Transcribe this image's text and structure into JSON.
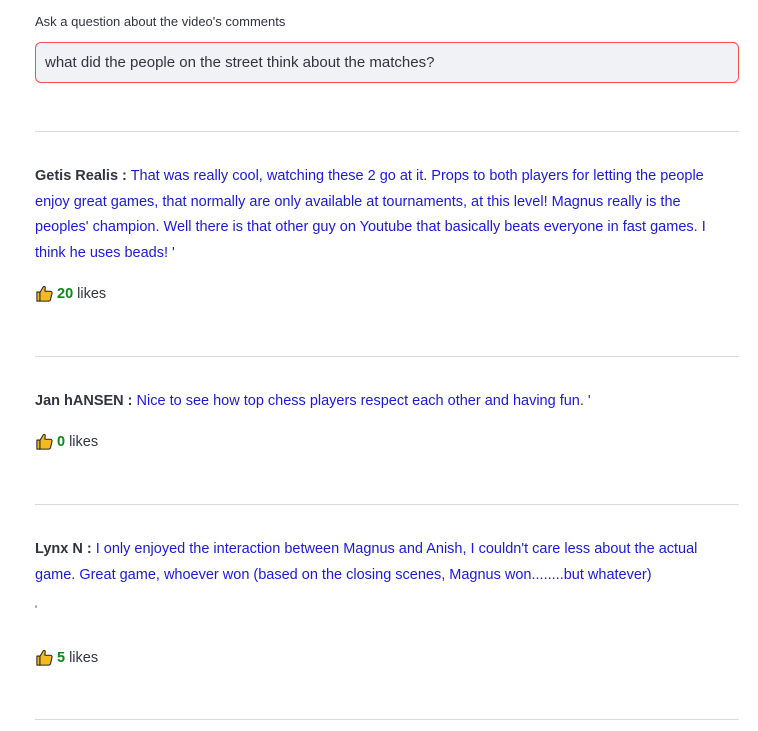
{
  "question": {
    "label": "Ask a question about the video's comments",
    "value": "what did the people on the street think about the matches?"
  },
  "comments": [
    {
      "author": "Getis Realis",
      "separator": ":",
      "text": "That was really cool, watching these 2 go at it. Props to both players for letting the people enjoy great games, that normally are only available at tournaments, at this level! Magnus really is the peoples' champion. Well there is that other guy on Youtube that basically beats everyone in fast games. I think he uses beads! '",
      "likes": "20",
      "likes_label": "likes"
    },
    {
      "author": "Jan hANSEN",
      "separator": ":",
      "text": "Nice to see how top chess players respect each other and having fun. '",
      "likes": "0",
      "likes_label": "likes"
    },
    {
      "author": "Lynx N",
      "separator": ":",
      "text": "I only enjoyed the interaction between Magnus and Anish, I couldn't care less about the actual game. Great game, whoever won (based on the closing scenes, Magnus won........but whatever)",
      "trailing": "'",
      "likes": "5",
      "likes_label": "likes"
    }
  ],
  "icons": {
    "like": "thumbs-up-icon"
  },
  "colors": {
    "comment_text": "#1a1ad8",
    "like_count": "#0a8a16",
    "input_border_focus": "#ff4b4b",
    "input_background": "#f0f2f6",
    "thumb_fill": "#f5b921"
  }
}
